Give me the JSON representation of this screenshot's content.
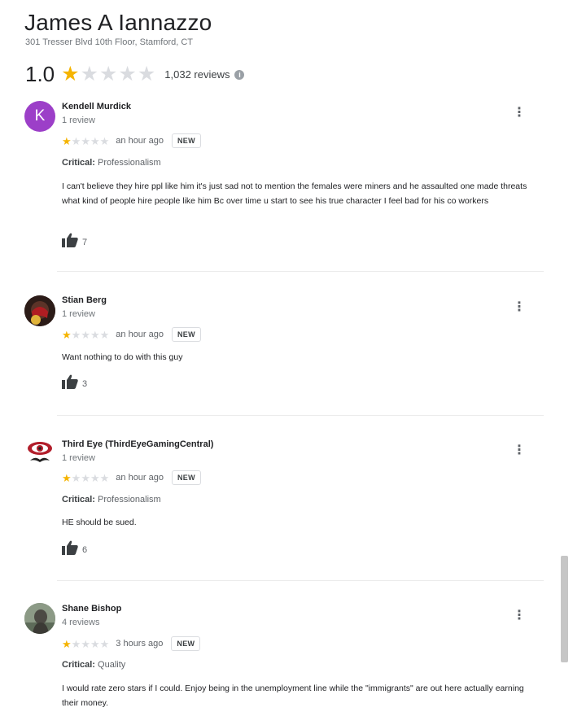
{
  "place": {
    "name": "James A Iannazzo",
    "address": "301 Tresser Blvd 10th Floor, Stamford, CT",
    "rating": "1.0",
    "rating_value": 1,
    "review_count": "1,032 reviews",
    "star_color": "#f5b400"
  },
  "reviews": [
    {
      "name": "Kendell Murdick",
      "avatar_letter": "K",
      "avatar_color": "#9c3fc8",
      "subcount": "1 review",
      "stars": 1,
      "time": "an hour ago",
      "badge": "NEW",
      "critical_label": "Critical:",
      "critical_value": "Professionalism",
      "text": "I can't believe they hire ppl like him it's just sad not to mention the females were miners and he assaulted one made threats what kind of people hire people like him Bc over time u start to see his true character I feel bad for his co workers",
      "likes": "7"
    },
    {
      "name": "Stian Berg",
      "subcount": "1 review",
      "stars": 1,
      "time": "an hour ago",
      "badge": "NEW",
      "text": "Want nothing to do with this guy",
      "likes": "3"
    },
    {
      "name": "Third Eye (ThirdEyeGamingCentral)",
      "subcount": "1 review",
      "stars": 1,
      "time": "an hour ago",
      "badge": "NEW",
      "critical_label": "Critical:",
      "critical_value": "Professionalism",
      "text": "HE should be sued.",
      "likes": "6"
    },
    {
      "name": "Shane Bishop",
      "subcount": "4 reviews",
      "stars": 1,
      "time": "3 hours ago",
      "badge": "NEW",
      "critical_label": "Critical:",
      "critical_value": "Quality",
      "text": "I would rate zero stars if I could. Enjoy being in the unemployment line while the \"immigrants\" are out here actually earning their money."
    }
  ],
  "icons": {
    "info": "info-icon",
    "thumbs_up": "thumbs-up-icon",
    "more": "more-vert-icon",
    "star": "star-icon"
  }
}
